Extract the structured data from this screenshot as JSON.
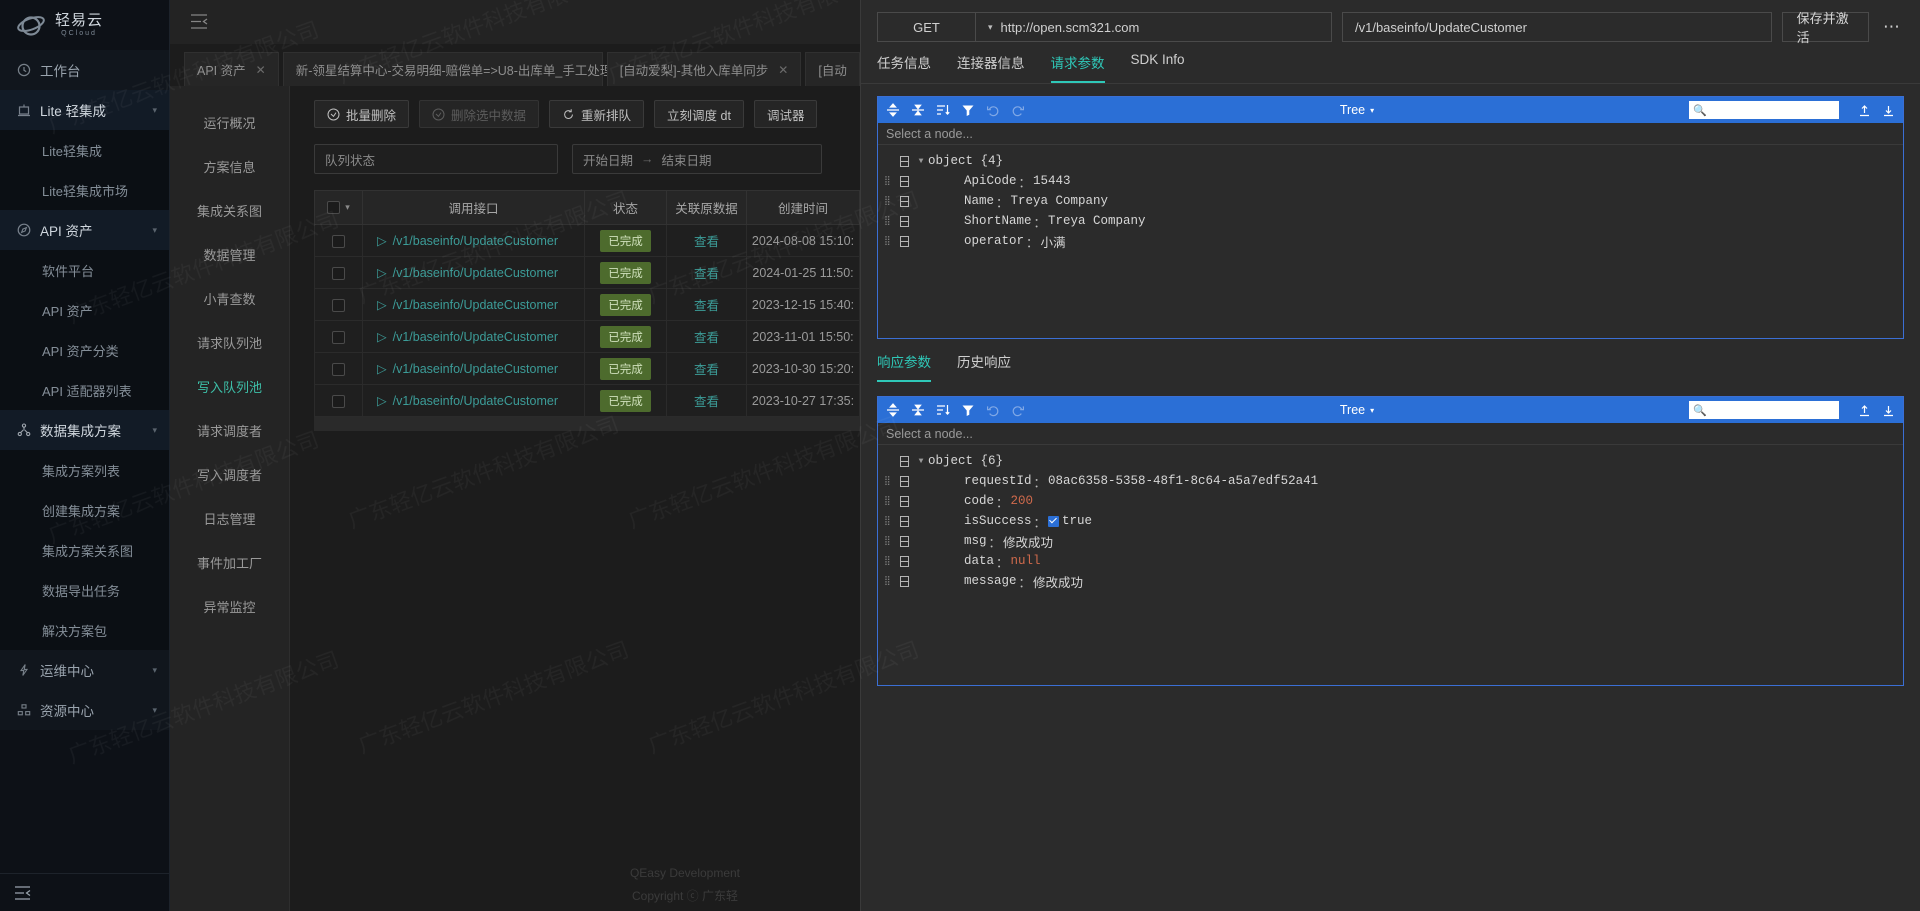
{
  "brand": {
    "cn": "轻易云",
    "en": "QCloud"
  },
  "sidebar": {
    "items": [
      {
        "label": "工作台",
        "icon": "clock-icon",
        "type": "top"
      },
      {
        "label": "Lite 轻集成",
        "icon": "lite-icon",
        "type": "top"
      },
      {
        "label": "Lite轻集成",
        "type": "sub"
      },
      {
        "label": "Lite轻集成市场",
        "type": "sub"
      },
      {
        "label": "API 资产",
        "icon": "compass-icon",
        "type": "top"
      },
      {
        "label": "软件平台",
        "type": "sub"
      },
      {
        "label": "API 资产",
        "type": "sub"
      },
      {
        "label": "API 资产分类",
        "type": "sub"
      },
      {
        "label": "API 适配器列表",
        "type": "sub"
      },
      {
        "label": "数据集成方案",
        "icon": "sitemap-icon",
        "type": "top"
      },
      {
        "label": "集成方案列表",
        "type": "sub"
      },
      {
        "label": "创建集成方案",
        "type": "sub"
      },
      {
        "label": "集成方案关系图",
        "type": "sub"
      },
      {
        "label": "数据导出任务",
        "type": "sub"
      },
      {
        "label": "解决方案包",
        "type": "sub"
      },
      {
        "label": "运维中心",
        "icon": "bolt-icon",
        "type": "top"
      },
      {
        "label": "资源中心",
        "icon": "resource-icon",
        "type": "top"
      }
    ]
  },
  "tabs": [
    {
      "label": "API 资产"
    },
    {
      "label": "新-领星结算中心-交易明细-赔偿单=>U8-出库单_手工处理"
    },
    {
      "label": "[自动爱梨]-其他入库单同步"
    },
    {
      "label": "[自动"
    }
  ],
  "menu_col": {
    "items": [
      {
        "label": "运行概况"
      },
      {
        "label": "方案信息"
      },
      {
        "label": "集成关系图"
      },
      {
        "label": "数据管理"
      },
      {
        "label": "小青查数"
      },
      {
        "label": "请求队列池"
      },
      {
        "label": "写入队列池",
        "active": true
      },
      {
        "label": "请求调度者"
      },
      {
        "label": "写入调度者"
      },
      {
        "label": "日志管理"
      },
      {
        "label": "事件加工厂"
      },
      {
        "label": "异常监控"
      }
    ]
  },
  "toolbar": {
    "batch_delete": "批量删除",
    "delete_selected": "删除选中数据",
    "requeue": "重新排队",
    "schedule_now": "立刻调度 dt",
    "debugger": "调试器"
  },
  "filters": {
    "queue_status_placeholder": "队列状态",
    "start_date_placeholder": "开始日期",
    "end_date_placeholder": "结束日期",
    "range_arrow": "→"
  },
  "table": {
    "columns": [
      "",
      "调用接口",
      "状态",
      "关联原数据",
      "创建时间"
    ],
    "rows": [
      {
        "api": "/v1/baseinfo/UpdateCustomer",
        "status": "已完成",
        "link": "查看",
        "time": "2024-08-08 15:10:"
      },
      {
        "api": "/v1/baseinfo/UpdateCustomer",
        "status": "已完成",
        "link": "查看",
        "time": "2024-01-25 11:50:"
      },
      {
        "api": "/v1/baseinfo/UpdateCustomer",
        "status": "已完成",
        "link": "查看",
        "time": "2023-12-15 15:40:"
      },
      {
        "api": "/v1/baseinfo/UpdateCustomer",
        "status": "已完成",
        "link": "查看",
        "time": "2023-11-01 15:50:"
      },
      {
        "api": "/v1/baseinfo/UpdateCustomer",
        "status": "已完成",
        "link": "查看",
        "time": "2023-10-30 15:20:"
      },
      {
        "api": "/v1/baseinfo/UpdateCustomer",
        "status": "已完成",
        "link": "查看",
        "time": "2023-10-27 17:35:"
      }
    ]
  },
  "footer": {
    "line1": "QEasy Development",
    "line2": "Copyright ⓒ 广东轻"
  },
  "api_panel": {
    "method": "GET",
    "host": "http://open.scm321.com",
    "path": "/v1/baseinfo/UpdateCustomer",
    "save_label": "保存并激活",
    "more": "⋯",
    "tabs": [
      {
        "label": "任务信息",
        "active": false
      },
      {
        "label": "连接器信息",
        "active": false
      },
      {
        "label": "请求参数",
        "active": true
      },
      {
        "label": "SDK Info",
        "active": false
      }
    ],
    "request_editor": {
      "mode": "Tree",
      "select_placeholder": "Select a node...",
      "root": "object  {4}",
      "nodes": [
        {
          "key": "ApiCode",
          "value": "15443",
          "type": "num"
        },
        {
          "key": "Name",
          "value": "Treya Company",
          "type": "str"
        },
        {
          "key": "ShortName",
          "value": "Treya Company",
          "type": "str"
        },
        {
          "key": "operator",
          "value": "小满",
          "type": "str"
        }
      ]
    },
    "response_tabs": [
      {
        "label": "响应参数",
        "active": true
      },
      {
        "label": "历史响应",
        "active": false
      }
    ],
    "response_editor": {
      "mode": "Tree",
      "select_placeholder": "Select a node...",
      "root": "object  {6}",
      "nodes": [
        {
          "key": "requestId",
          "value": "08ac6358-5358-48f1-8c64-a5a7edf52a41",
          "type": "str"
        },
        {
          "key": "code",
          "value": "200",
          "type": "num"
        },
        {
          "key": "isSuccess",
          "value": "true",
          "type": "bool"
        },
        {
          "key": "msg",
          "value": "修改成功",
          "type": "str"
        },
        {
          "key": "data",
          "value": "null",
          "type": "null"
        },
        {
          "key": "message",
          "value": "修改成功",
          "type": "str"
        }
      ]
    }
  },
  "watermark": "广东轻亿云软件科技有限公司",
  "colors": {
    "accent_teal": "#2fc8b8",
    "editor_blue": "#2b6fd6",
    "badge_green": "#4d6b2d",
    "sidebar_bg": "#0d1117"
  }
}
